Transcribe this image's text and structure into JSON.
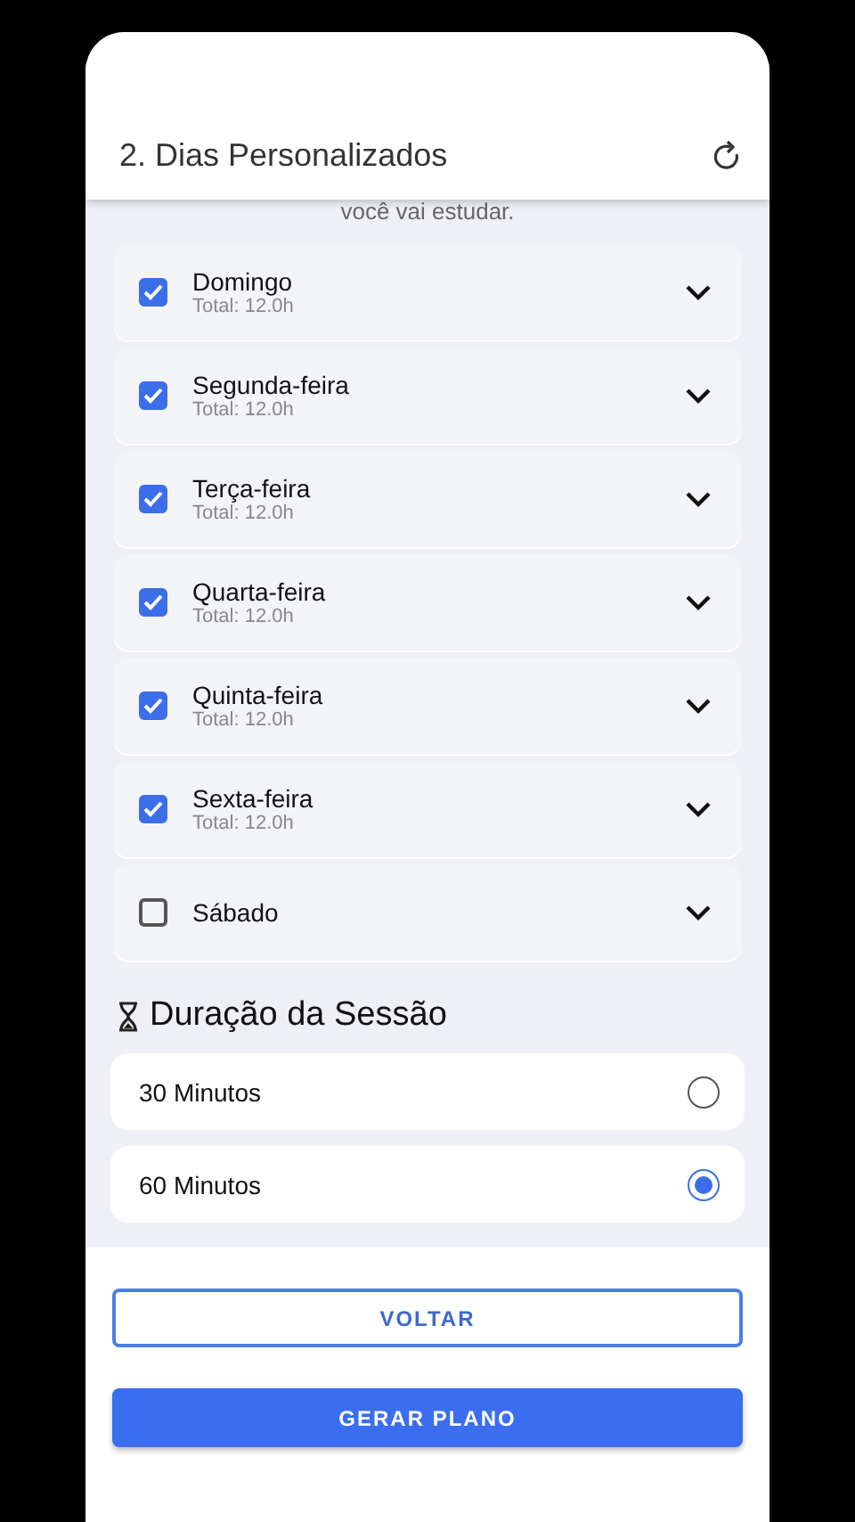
{
  "header": {
    "title": "2. Dias Personalizados"
  },
  "subtitle": "você vai estudar.",
  "days": [
    {
      "name": "Domingo",
      "total": "Total: 12.0h",
      "checked": true
    },
    {
      "name": "Segunda-feira",
      "total": "Total: 12.0h",
      "checked": true
    },
    {
      "name": "Terça-feira",
      "total": "Total: 12.0h",
      "checked": true
    },
    {
      "name": "Quarta-feira",
      "total": "Total: 12.0h",
      "checked": true
    },
    {
      "name": "Quinta-feira",
      "total": "Total: 12.0h",
      "checked": true
    },
    {
      "name": "Sexta-feira",
      "total": "Total: 12.0h",
      "checked": true
    },
    {
      "name": "Sábado",
      "checked": false
    }
  ],
  "session": {
    "title": "Duração da Sessão",
    "options": [
      {
        "label": "30 Minutos",
        "selected": false
      },
      {
        "label": "60 Minutos",
        "selected": true
      }
    ]
  },
  "buttons": [
    {
      "label": "VOLTAR",
      "kind": "outlined"
    },
    {
      "label": "GERAR PLANO",
      "kind": "filled"
    }
  ]
}
